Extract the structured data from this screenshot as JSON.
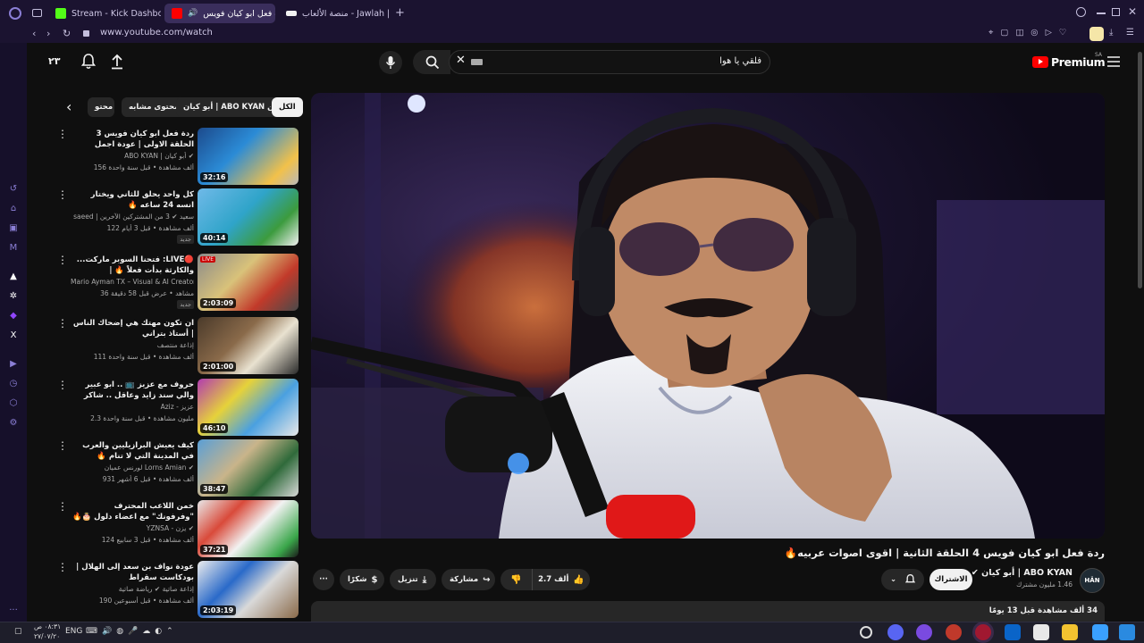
{
  "browser": {
    "tabs": [
      {
        "label": "Stream - Kick Dashboard",
        "active": false
      },
      {
        "label": "ردة فعل ابو كيان فويس",
        "active": true
      },
      {
        "label": "جولة | Jawlah - منصة الألعاب",
        "active": false
      }
    ],
    "url": "www.youtube.com/watch",
    "new_tab_symbol": "+"
  },
  "youtube": {
    "logo_text": "Premium",
    "logo_region": "SA",
    "search_value": "فلقي يا هوا",
    "notification_label": "٢٣",
    "chips": [
      {
        "label": "الكل",
        "selected": true
      },
      {
        "label": "من ABO KYAN | أبو كيان",
        "selected": false
      },
      {
        "label": "محتوى مشابه",
        "selected": false
      },
      {
        "label": "محتو",
        "selected": false
      }
    ],
    "recommendations": [
      {
        "title": "ردة فعل ابو كيان فويس 3 الحلقة الاولى | عودة اجمل اصوات 🔥 The voice",
        "channel": "ABO KYAN | أبو كيان ✔",
        "meta": "156 ألف مشاهدة • قبل سنة واحدة",
        "duration": "32:16",
        "badge": ""
      },
      {
        "title": "كل واحد يحلق للثاني ويختار انسه 24 ساعه 🔥",
        "channel": "saeed | سعيد ✔ 3 من المشتركين الآخرين",
        "meta": "122 ألف مشاهدة • قبل 3 أيام",
        "duration": "40:14",
        "badge": "جديد"
      },
      {
        "title": "🔴LIVE: فتحنا السوبر ماركت... والكارثة بدأت فعلاً 🔥 | Supermarket",
        "channel": "Mario Ayman TX – Visual & AI Creator",
        "meta": "36 مشاهد • عرض قبل 58 دقيقة",
        "duration": "2:03:09",
        "badge": "جديد"
      },
      {
        "title": "ان تكون مهتك هي إضحاك الناس | أستاذ بتراني",
        "channel": "إذاعة منتصف",
        "meta": "111 ألف مشاهدة • قبل سنة واحدة",
        "duration": "2:01:00",
        "badge": ""
      },
      {
        "title": "حروف مع عزيز 📺 .. ابو عبير والي سند زايد وعاقل .. شاكر شاكر 😂 ❌",
        "channel": "Aziz - عزيز",
        "meta": "2.3 مليون مشاهدة • قبل سنة واحدة",
        "duration": "46:10",
        "badge": ""
      },
      {
        "title": "كيف يعيش البرازيليين والعرب في المدينة التي لا تنام 🔥",
        "channel": "لورنس عميان Lorns Amian ✔",
        "meta": "931 ألف مشاهدة • قبل 6 أشهر",
        "duration": "38:47",
        "badge": ""
      },
      {
        "title": "خمن اللاعب المحترف \"وفرفونك\" مع اعضاء دلول 🎂🔥 !",
        "channel": "YZNSA - يزن ✔",
        "meta": "124 ألف مشاهدة • قبل 3 سابيع",
        "duration": "37:21",
        "badge": ""
      },
      {
        "title": "عودة نواف بن سعد إلى الهلال | بودكاست سقراط",
        "channel": "إذاعة صاتية ✔ رياضة صاتية",
        "meta": "190 ألف مشاهدة • قبل أسبوعين",
        "duration": "2:03:19",
        "badge": ""
      }
    ],
    "video": {
      "title": "ردة فعل ابو كيان فويس 4 الحلقة الثانية | اقوى اصوات عربيه🔥",
      "channel": "ABO KYAN | أبو كيان ✔",
      "subscribers": "1.46 مليون مشترك",
      "subscribe_label": "الاشتراك",
      "avatar_text": "HÄN",
      "likes": "2.7 ألف",
      "share_label": "مشاركة",
      "download_label": "تنزيل",
      "thanks_label": "شكرًا",
      "description_header": "34 ألف مشاهدة قبل 13 يومًا"
    }
  },
  "taskbar": {
    "language": "ENG",
    "time": "٠٨:٣١ ص",
    "date": "٢٧/٠٧/٢٠"
  },
  "colors": {
    "accent_purple": "#8b7fd6",
    "youtube_red": "#ff0000",
    "kick_green": "#53fc18"
  },
  "icons": {
    "search": "search-icon",
    "mic": "mic-icon",
    "bell": "bell-icon",
    "upload": "upload-icon",
    "menu": "hamburger-icon"
  }
}
